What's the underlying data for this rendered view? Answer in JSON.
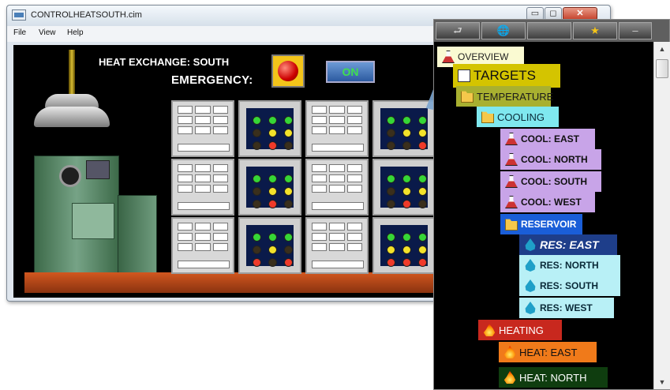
{
  "window": {
    "title": "CONTROLHEATSOUTH.cim",
    "menu": [
      "File",
      "View",
      "Help"
    ],
    "controls": {
      "minimize": "▭",
      "maximize": "◻",
      "close": "✕"
    }
  },
  "hmi": {
    "title": "HEAT EXCHANGE: SOUTH",
    "emergency_label": "EMERGENCY:",
    "on_button": "ON"
  },
  "tree": {
    "toolbar": [
      "⮐",
      "🌐",
      "",
      "★",
      "–"
    ],
    "nodes": [
      {
        "label": "OVERVIEW",
        "icon": "flask-icon",
        "bg": "#fafad2",
        "fg": "#222222"
      },
      {
        "label": "TARGETS",
        "icon": "checklist-icon",
        "bg": "#d4c400",
        "fg": "#111111"
      },
      {
        "label": "TEMPERATURE",
        "icon": "folder-icon",
        "bg": "#a8b030",
        "fg": "#1a1a1a"
      },
      {
        "label": "COOLING",
        "icon": "folder-icon",
        "bg": "#7fe8ef",
        "fg": "#0a2a38"
      },
      {
        "label": "COOL: EAST",
        "icon": "flask-icon",
        "bg": "#c8a4e8",
        "fg": "#111111"
      },
      {
        "label": "COOL: NORTH",
        "icon": "flask-icon",
        "bg": "#c8a4e8",
        "fg": "#111111"
      },
      {
        "label": "COOL: SOUTH",
        "icon": "flask-icon",
        "bg": "#c8a4e8",
        "fg": "#111111"
      },
      {
        "label": "COOL: WEST",
        "icon": "flask-icon",
        "bg": "#c8a4e8",
        "fg": "#111111"
      },
      {
        "label": "RESERVOIR",
        "icon": "folder-icon",
        "bg": "#1a5ed8",
        "fg": "#ffffff"
      },
      {
        "label": "RES: EAST",
        "icon": "water-drop-icon",
        "bg": "#1e3e8a",
        "fg": "#ffffff"
      },
      {
        "label": "RES: NORTH",
        "icon": "water-drop-icon",
        "bg": "#b8f0f6",
        "fg": "#0a2a38"
      },
      {
        "label": "RES: SOUTH",
        "icon": "water-drop-icon",
        "bg": "#b8f0f6",
        "fg": "#0a2a38"
      },
      {
        "label": "RES: WEST",
        "icon": "water-drop-icon",
        "bg": "#b8f0f6",
        "fg": "#0a2a38"
      },
      {
        "label": "HEATING",
        "icon": "flame-icon",
        "bg": "#c8281e",
        "fg": "#ffffff"
      },
      {
        "label": "HEAT: EAST",
        "icon": "flame-icon",
        "bg": "#f07a1a",
        "fg": "#111111"
      },
      {
        "label": "HEAT: NORTH",
        "icon": "flame-icon",
        "bg": "#0f3d0f",
        "fg": "#ffffff"
      }
    ]
  }
}
